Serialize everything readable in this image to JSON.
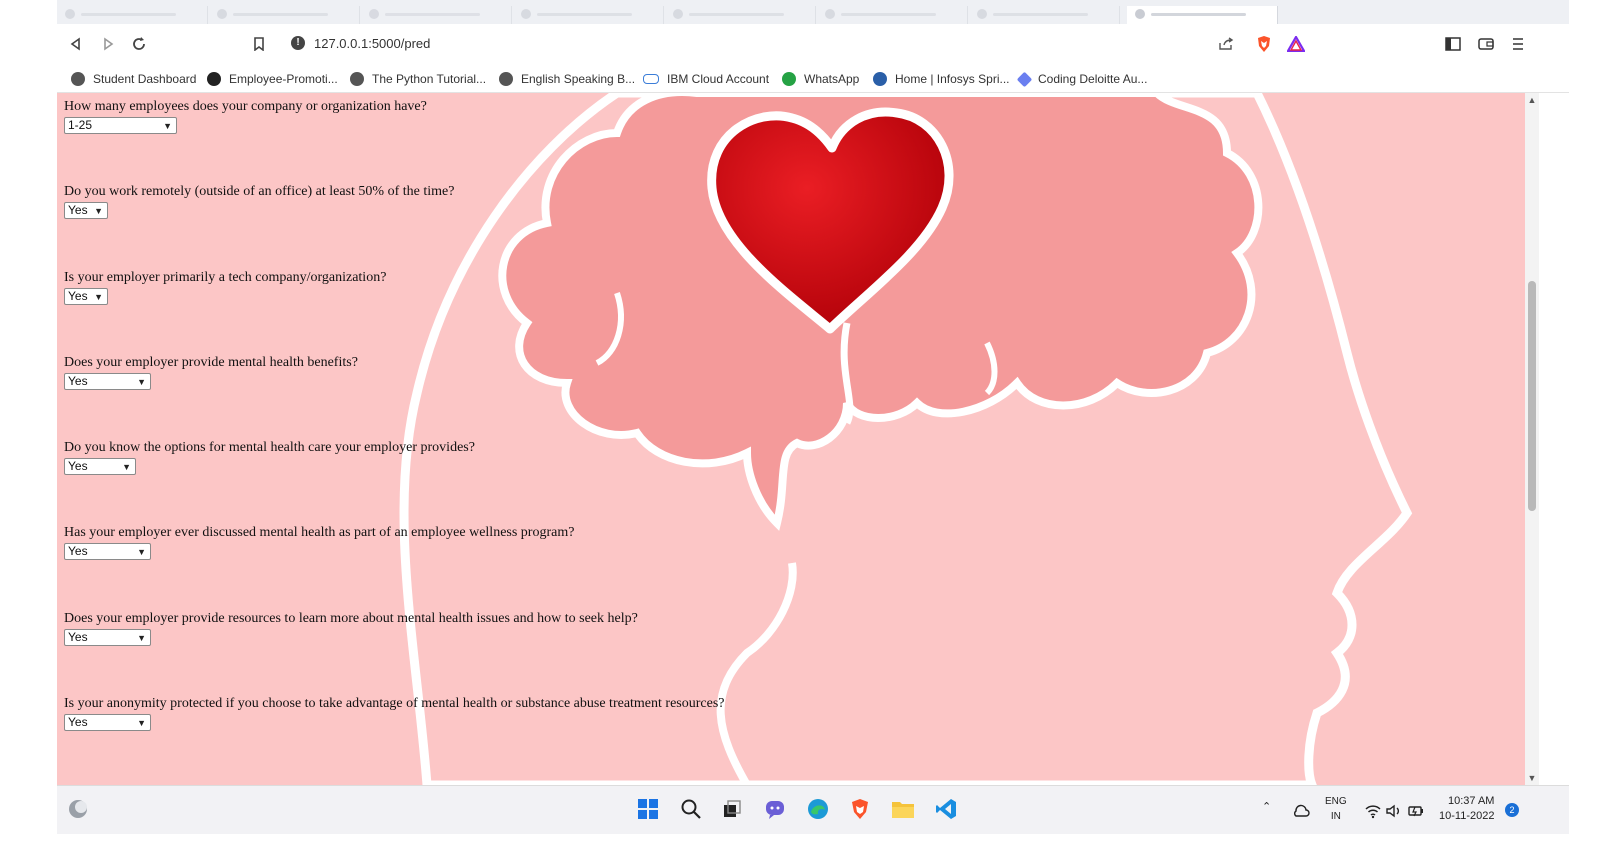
{
  "browser": {
    "url": "127.0.0.1:5000/pred",
    "bookmarks": [
      {
        "label": "Student Dashboard",
        "icon": "globe-icon"
      },
      {
        "label": "Employee-Promoti...",
        "icon": "github-icon"
      },
      {
        "label": "The Python Tutorial...",
        "icon": "globe-icon"
      },
      {
        "label": "English Speaking B...",
        "icon": "globe-icon"
      },
      {
        "label": "IBM Cloud Account",
        "icon": "cloud-icon"
      },
      {
        "label": "WhatsApp",
        "icon": "whatsapp-icon"
      },
      {
        "label": "Home | Infosys Spri...",
        "icon": "infosys-icon"
      },
      {
        "label": "Coding Deloitte Au...",
        "icon": "gem-icon"
      }
    ]
  },
  "form": {
    "questions": [
      {
        "label": "How many employees does your company or organization have?",
        "value": "1-25"
      },
      {
        "label": "Do you work remotely (outside of an office) at least 50% of the time?",
        "value": "Yes"
      },
      {
        "label": "Is your employer primarily a tech company/organization?",
        "value": "Yes"
      },
      {
        "label": "Does your employer provide mental health benefits?",
        "value": "Yes"
      },
      {
        "label": "Do you know the options for mental health care your employer provides?",
        "value": "Yes"
      },
      {
        "label": "Has your employer ever discussed mental health as part of an employee wellness program?",
        "value": "Yes"
      },
      {
        "label": "Does your employer provide resources to learn more about mental health issues and how to seek help?",
        "value": "Yes"
      },
      {
        "label": "Is your anonymity protected if you choose to take advantage of mental health or substance abuse treatment resources?",
        "value": "Yes"
      }
    ]
  },
  "taskbar": {
    "lang_top": "ENG",
    "lang_bottom": "IN",
    "time": "10:37 AM",
    "date": "10-11-2022",
    "notifications": "2"
  },
  "colors": {
    "page_bg": "#fcc6c6",
    "brain": "#f49a9a",
    "heart": "#d40d14"
  }
}
